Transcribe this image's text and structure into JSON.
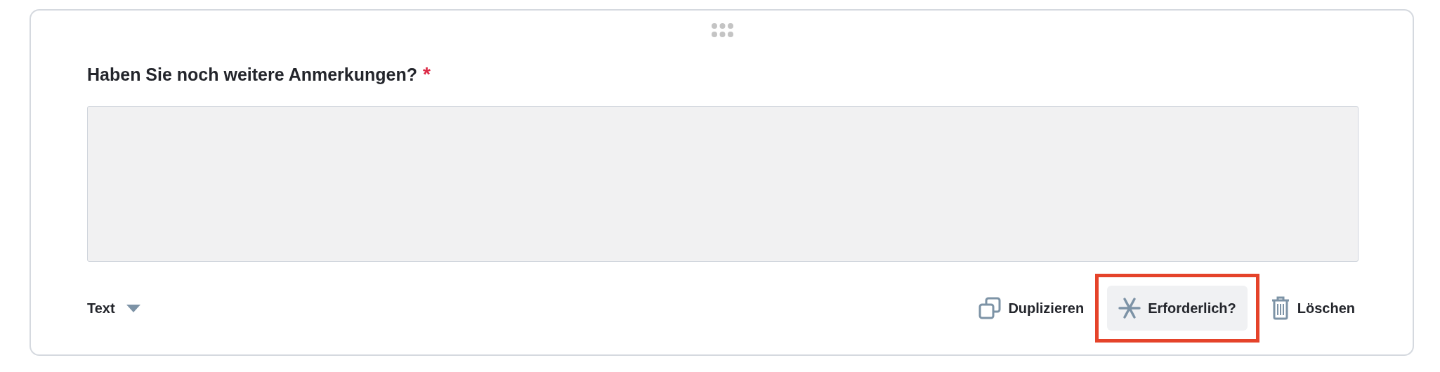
{
  "question": {
    "title": "Haben Sie noch weitere Anmerkungen?",
    "required_mark": "*"
  },
  "answer_field": {
    "kind": "textarea"
  },
  "type_select": {
    "value": "Text"
  },
  "actions": [
    {
      "kind": "duplicate",
      "label": "Duplizieren",
      "active": false,
      "highlighted": false
    },
    {
      "kind": "required",
      "label": "Erforderlich?",
      "active": true,
      "highlighted": true
    },
    {
      "kind": "delete",
      "label": "Löschen",
      "active": false,
      "highlighted": false
    }
  ]
}
